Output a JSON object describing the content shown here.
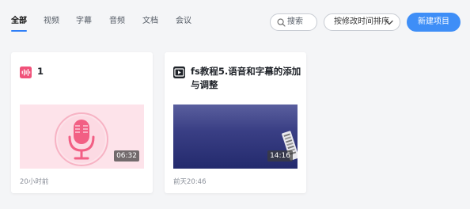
{
  "tabs": [
    {
      "label": "全部",
      "active": true
    },
    {
      "label": "视频",
      "active": false
    },
    {
      "label": "字幕",
      "active": false
    },
    {
      "label": "音频",
      "active": false
    },
    {
      "label": "文档",
      "active": false
    },
    {
      "label": "会议",
      "active": false
    }
  ],
  "toolbar": {
    "search_placeholder": "搜索",
    "sort_label": "按修改时间排序",
    "new_project_label": "新建项目"
  },
  "projects": [
    {
      "title": "1",
      "type": "audio",
      "type_icon": "audio-wave-icon",
      "duration": "06:32",
      "time": "20小时前"
    },
    {
      "title": "fs教程5.语音和字幕的添加与调整",
      "type": "video",
      "type_icon": "video-icon",
      "duration": "14:16",
      "time": "前天20:46"
    }
  ],
  "colors": {
    "accent": "#3e8ef7",
    "audio_pink": "#f0527a"
  }
}
